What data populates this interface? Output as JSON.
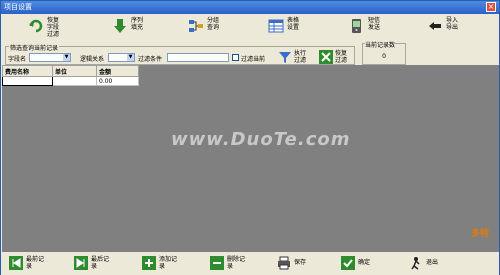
{
  "window": {
    "title": "项目设置"
  },
  "toolbar": {
    "items": [
      {
        "label": "恢复\n字段\n过滤",
        "icon": "restore-filter-icon",
        "color": "#2e8b2e"
      },
      {
        "label": "序列\n填充",
        "icon": "arrow-down-icon",
        "color": "#2e8b2e"
      },
      {
        "label": "分组\n查询",
        "icon": "group-query-icon",
        "color": "#3a6ec8"
      },
      {
        "label": "表格\n设置",
        "icon": "table-settings-icon",
        "color": "#3a6ec8"
      },
      {
        "label": "短信\n发送",
        "icon": "sms-icon",
        "color": "#2e8b2e"
      },
      {
        "label": "导入\n导出",
        "icon": "import-export-icon",
        "color": "#000000"
      }
    ]
  },
  "filter": {
    "legend": "筛选查询当前记录",
    "field_label": "字段名",
    "logic_label": "逻辑关系",
    "condition_label": "过滤条件",
    "filter_current_label": "过滤当前",
    "apply_label": "执行\n过滤",
    "restore_label": "恢复\n过滤"
  },
  "count": {
    "legend": "当前记录数",
    "value": "0"
  },
  "grid": {
    "columns": [
      "费用名称",
      "单位",
      "金额"
    ],
    "rows": [
      [
        "",
        "",
        "0.00"
      ]
    ]
  },
  "watermark": "www.DuoTe.com",
  "bottom": {
    "items": [
      {
        "label": "最前记\n录",
        "icon": "first-record-icon"
      },
      {
        "label": "最后记\n录",
        "icon": "last-record-icon"
      },
      {
        "label": "添加记\n录",
        "icon": "add-record-icon"
      },
      {
        "label": "删除记\n录",
        "icon": "delete-record-icon"
      },
      {
        "label": "保存",
        "icon": "save-icon"
      },
      {
        "label": "确定",
        "icon": "confirm-icon"
      },
      {
        "label": "退出",
        "icon": "exit-icon"
      }
    ]
  },
  "logo_text": "多特"
}
